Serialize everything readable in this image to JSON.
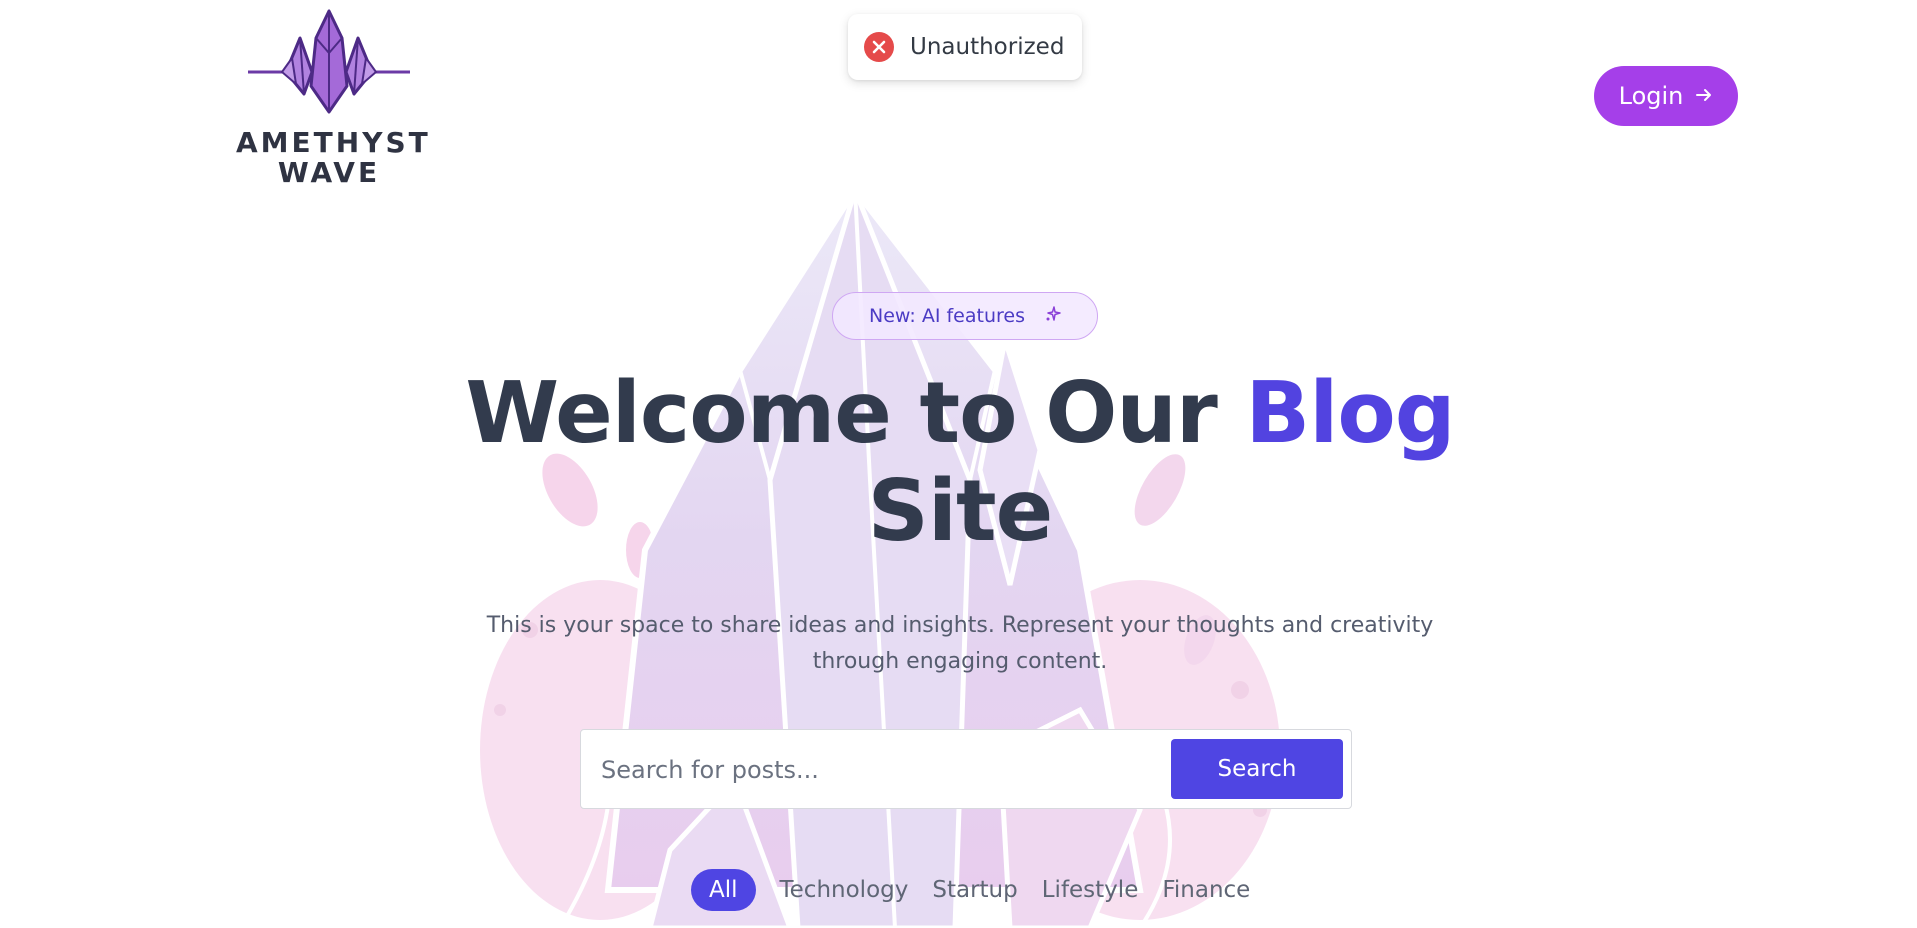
{
  "brand": {
    "line1": "AMETHYST",
    "line2": "WAVE"
  },
  "toast": {
    "icon": "error-x-icon",
    "message": "Unauthorized"
  },
  "nav": {
    "login_label": "Login",
    "login_icon": "arrow-right-icon"
  },
  "hero": {
    "badge_label": "New: AI features",
    "badge_icon": "sparkle-icon",
    "title_part1": "Welcome to Our ",
    "title_accent": "Blog",
    "title_part2": "Site",
    "subtitle": "This is your space to share ideas and insights. Represent your thoughts and creativity through engaging content."
  },
  "search": {
    "placeholder": "Search for posts...",
    "value": "",
    "button_label": "Search"
  },
  "categories": [
    {
      "label": "All",
      "active": true
    },
    {
      "label": "Technology",
      "active": false
    },
    {
      "label": "Startup",
      "active": false
    },
    {
      "label": "Lifestyle",
      "active": false
    },
    {
      "label": "Finance",
      "active": false
    }
  ],
  "colors": {
    "primary": "#4f45e3",
    "login": "#a53fe9",
    "accent_text": "#5243e0",
    "title_text": "#323b4d",
    "error": "#e54a4a"
  }
}
